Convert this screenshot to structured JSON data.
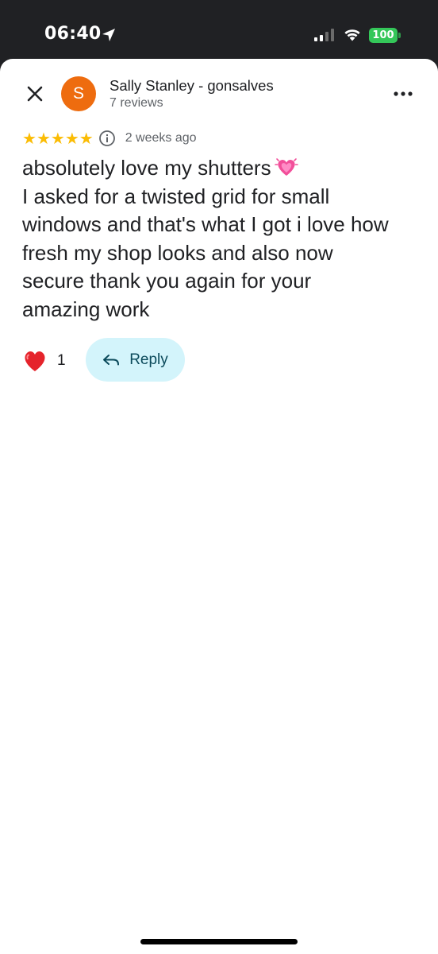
{
  "status_bar": {
    "time": "06:40",
    "battery": "100",
    "icons": [
      "location-arrow-icon",
      "cellular-signal-icon",
      "wifi-icon",
      "battery-icon"
    ]
  },
  "review": {
    "reviewer_name": "Sally Stanley - gonsalves",
    "reviewer_meta": "7 reviews",
    "avatar_letter": "S",
    "avatar_color": "#ee6c0f",
    "stars": 5,
    "star_glyphs": [
      "★",
      "★",
      "★",
      "★",
      "★"
    ],
    "star_color": "#fbbc04",
    "date": "2 weeks ago",
    "text_lines": [
      "absolutely love my shutters",
      "I asked for a twisted grid for small",
      "windows and that's what I got i love how",
      "fresh my shop looks and also now",
      "secure thank you again for your",
      "amazing work"
    ],
    "inline_emoji": "beating-heart-emoji-icon"
  },
  "actions": {
    "like_count": "1",
    "reply_label": "Reply",
    "reply_bg": "#d3f4fb"
  }
}
